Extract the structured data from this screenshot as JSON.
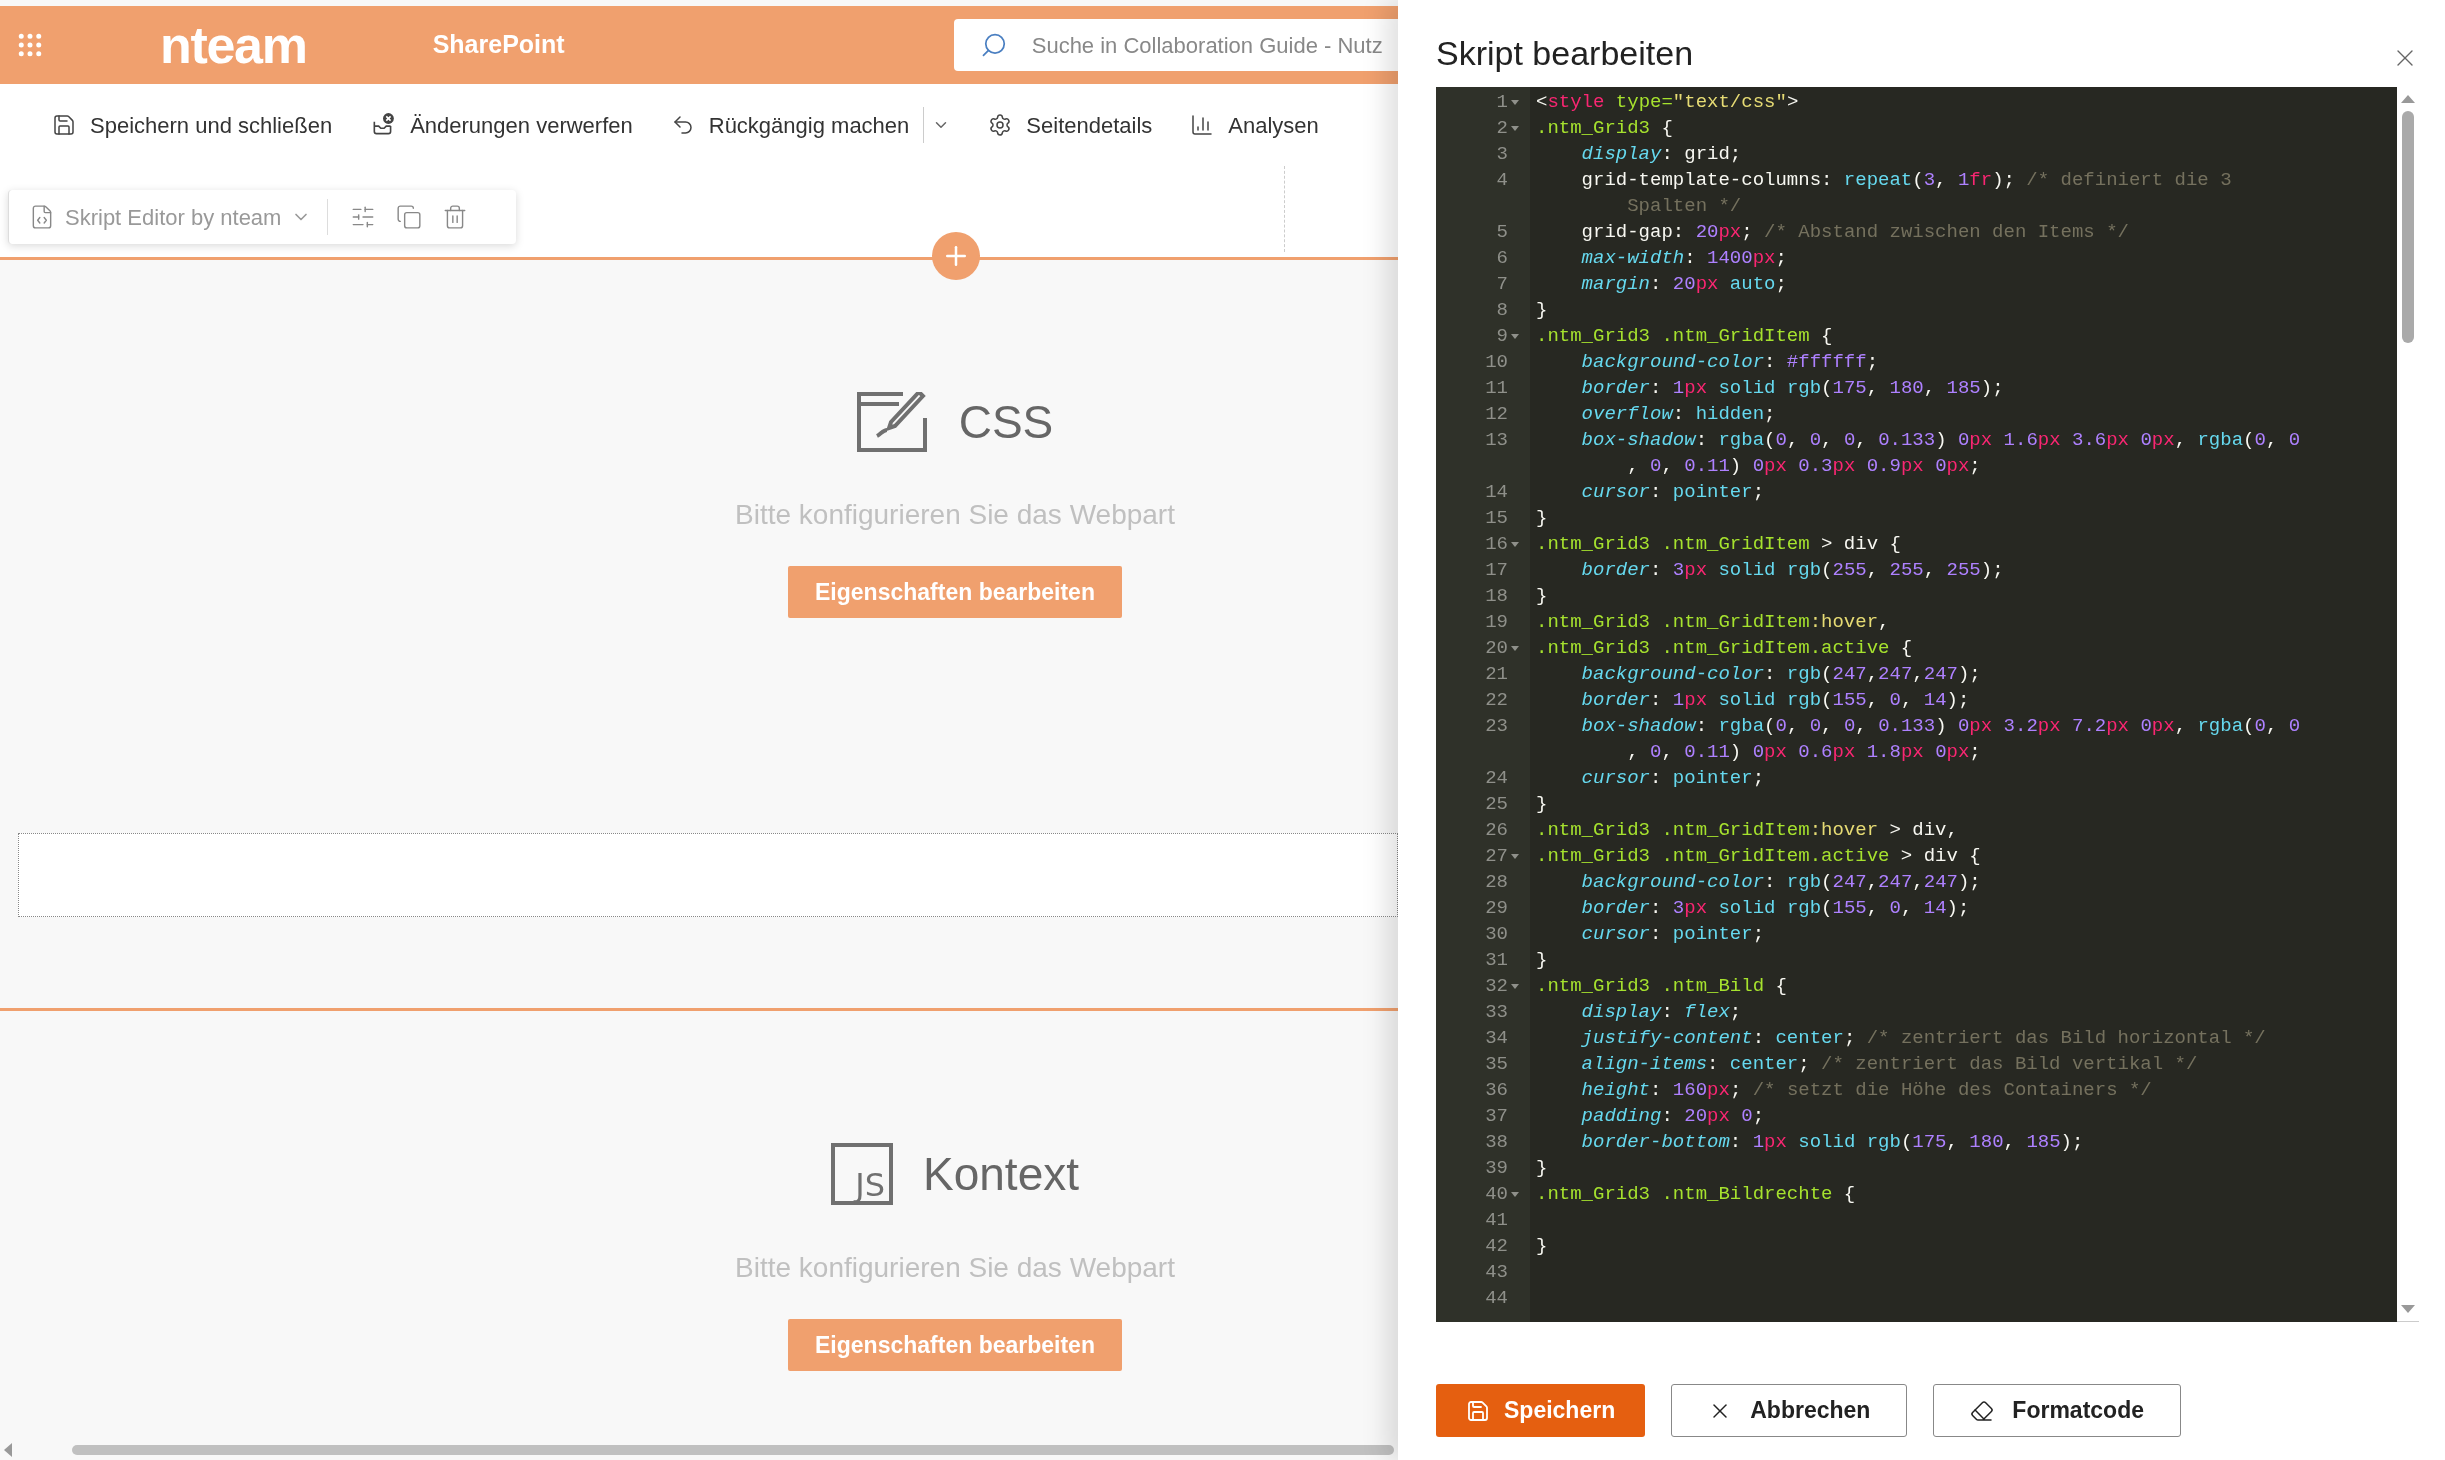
{
  "top_bar": {
    "logo": "nteam",
    "site_name": "SharePoint",
    "search": {
      "placeholder": "Suche in Collaboration Guide - Nutz"
    }
  },
  "command_bar": [
    {
      "label": "Speichern und schließen",
      "dropdown": false
    },
    {
      "label": "Änderungen verwerfen",
      "dropdown": false
    },
    {
      "label": "Rückgängig machen",
      "dropdown": true
    },
    {
      "label": "Seitendetails",
      "dropdown": false
    },
    {
      "label": "Analysen",
      "dropdown": false
    }
  ],
  "webpart_toolbar": {
    "title": "Skript Editor by nteam"
  },
  "sections": [
    {
      "kind": "css",
      "title": "CSS",
      "message": "Bitte konfigurieren Sie das Webpart",
      "button": "Eigenschaften bearbeiten"
    },
    {
      "kind": "js",
      "icon_text": "JS",
      "title": "Kontext",
      "message": "Bitte konfigurieren Sie das Webpart",
      "button": "Eigenschaften bearbeiten"
    }
  ],
  "panel": {
    "title": "Skript bearbeiten",
    "editor": [
      {
        "number": "1",
        "foldable": true,
        "code": [
          {
            "kind": "plain",
            "text": "<"
          },
          {
            "kind": "tag",
            "text": "style"
          },
          {
            "kind": "attr",
            "text": " type="
          },
          {
            "kind": "str",
            "text": "\"text/css\""
          },
          {
            "kind": "plain",
            "text": ">"
          }
        ]
      },
      {
        "number": "2",
        "foldable": true,
        "code": [
          {
            "kind": "sel",
            "text": ".ntm_Grid3"
          },
          {
            "kind": "plain",
            "text": " {"
          }
        ]
      },
      {
        "number": "3",
        "foldable": false,
        "code": [
          {
            "kind": "prop",
            "text": "    display"
          },
          {
            "kind": "plain",
            "text": ": grid;"
          }
        ]
      },
      {
        "number": "4",
        "foldable": false,
        "code": [
          {
            "kind": "plain",
            "text": "    grid-template-columns: "
          },
          {
            "kind": "kw",
            "text": "repeat"
          },
          {
            "kind": "plain",
            "text": "("
          },
          {
            "kind": "num",
            "text": "3"
          },
          {
            "kind": "plain",
            "text": ", "
          },
          {
            "kind": "num",
            "text": "1"
          },
          {
            "kind": "unit",
            "text": "fr"
          },
          {
            "kind": "plain",
            "text": "); "
          },
          {
            "kind": "com",
            "text": "/* definiert die 3"
          }
        ],
        "continuation": [
          {
            "kind": "com",
            "text": "        Spalten */"
          }
        ]
      },
      {
        "number": "5",
        "foldable": false,
        "code": [
          {
            "kind": "plain",
            "text": "    grid-gap: "
          },
          {
            "kind": "num",
            "text": "20"
          },
          {
            "kind": "unit",
            "text": "px"
          },
          {
            "kind": "plain",
            "text": "; "
          },
          {
            "kind": "com",
            "text": "/* Abstand zwischen den Items */"
          }
        ]
      },
      {
        "number": "6",
        "foldable": false,
        "code": [
          {
            "kind": "prop",
            "text": "    max-width"
          },
          {
            "kind": "plain",
            "text": ": "
          },
          {
            "kind": "num",
            "text": "1400"
          },
          {
            "kind": "unit",
            "text": "px"
          },
          {
            "kind": "plain",
            "text": ";"
          }
        ]
      },
      {
        "number": "7",
        "foldable": false,
        "code": [
          {
            "kind": "prop",
            "text": "    margin"
          },
          {
            "kind": "plain",
            "text": ": "
          },
          {
            "kind": "num",
            "text": "20"
          },
          {
            "kind": "unit",
            "text": "px"
          },
          {
            "kind": "kw",
            "text": " auto"
          },
          {
            "kind": "plain",
            "text": ";"
          }
        ]
      },
      {
        "number": "8",
        "foldable": false,
        "code": [
          {
            "kind": "plain",
            "text": "}"
          }
        ]
      },
      {
        "number": "9",
        "foldable": true,
        "code": [
          {
            "kind": "sel",
            "text": ".ntm_Grid3 .ntm_GridItem"
          },
          {
            "kind": "plain",
            "text": " {"
          }
        ]
      },
      {
        "number": "10",
        "foldable": false,
        "code": [
          {
            "kind": "prop",
            "text": "    background-color"
          },
          {
            "kind": "plain",
            "text": ": "
          },
          {
            "kind": "num",
            "text": "#ffffff"
          },
          {
            "kind": "plain",
            "text": ";"
          }
        ]
      },
      {
        "number": "11",
        "foldable": false,
        "code": [
          {
            "kind": "prop",
            "text": "    border"
          },
          {
            "kind": "plain",
            "text": ": "
          },
          {
            "kind": "num",
            "text": "1"
          },
          {
            "kind": "unit",
            "text": "px"
          },
          {
            "kind": "kw",
            "text": " solid"
          },
          {
            "kind": "kw",
            "text": " rgb"
          },
          {
            "kind": "plain",
            "text": "("
          },
          {
            "kind": "num",
            "text": "175"
          },
          {
            "kind": "plain",
            "text": ", "
          },
          {
            "kind": "num",
            "text": "180"
          },
          {
            "kind": "plain",
            "text": ", "
          },
          {
            "kind": "num",
            "text": "185"
          },
          {
            "kind": "plain",
            "text": ");"
          }
        ]
      },
      {
        "number": "12",
        "foldable": false,
        "code": [
          {
            "kind": "prop",
            "text": "    overflow"
          },
          {
            "kind": "plain",
            "text": ": "
          },
          {
            "kind": "kw",
            "text": "hidden"
          },
          {
            "kind": "plain",
            "text": ";"
          }
        ]
      },
      {
        "number": "13",
        "foldable": false,
        "code": [
          {
            "kind": "prop",
            "text": "    box-shadow"
          },
          {
            "kind": "plain",
            "text": ": "
          },
          {
            "kind": "kw",
            "text": "rgba"
          },
          {
            "kind": "plain",
            "text": "("
          },
          {
            "kind": "num",
            "text": "0"
          },
          {
            "kind": "plain",
            "text": ", "
          },
          {
            "kind": "num",
            "text": "0"
          },
          {
            "kind": "plain",
            "text": ", "
          },
          {
            "kind": "num",
            "text": "0"
          },
          {
            "kind": "plain",
            "text": ", "
          },
          {
            "kind": "num",
            "text": "0.133"
          },
          {
            "kind": "plain",
            "text": ") "
          },
          {
            "kind": "num",
            "text": "0"
          },
          {
            "kind": "unit",
            "text": "px"
          },
          {
            "kind": "num",
            "text": " 1.6"
          },
          {
            "kind": "unit",
            "text": "px"
          },
          {
            "kind": "num",
            "text": " 3.6"
          },
          {
            "kind": "unit",
            "text": "px"
          },
          {
            "kind": "num",
            "text": " 0"
          },
          {
            "kind": "unit",
            "text": "px"
          },
          {
            "kind": "plain",
            "text": ", "
          },
          {
            "kind": "kw",
            "text": "rgba"
          },
          {
            "kind": "plain",
            "text": "("
          },
          {
            "kind": "num",
            "text": "0"
          },
          {
            "kind": "plain",
            "text": ", "
          },
          {
            "kind": "num",
            "text": "0"
          }
        ],
        "continuation": [
          {
            "kind": "plain",
            "text": "        , "
          },
          {
            "kind": "num",
            "text": "0"
          },
          {
            "kind": "plain",
            "text": ", "
          },
          {
            "kind": "num",
            "text": "0.11"
          },
          {
            "kind": "plain",
            "text": ") "
          },
          {
            "kind": "num",
            "text": "0"
          },
          {
            "kind": "unit",
            "text": "px"
          },
          {
            "kind": "num",
            "text": " 0.3"
          },
          {
            "kind": "unit",
            "text": "px"
          },
          {
            "kind": "num",
            "text": " 0.9"
          },
          {
            "kind": "unit",
            "text": "px"
          },
          {
            "kind": "num",
            "text": " 0"
          },
          {
            "kind": "unit",
            "text": "px"
          },
          {
            "kind": "plain",
            "text": ";"
          }
        ]
      },
      {
        "number": "14",
        "foldable": false,
        "code": [
          {
            "kind": "prop",
            "text": "    cursor"
          },
          {
            "kind": "plain",
            "text": ": "
          },
          {
            "kind": "kw",
            "text": "pointer"
          },
          {
            "kind": "plain",
            "text": ";"
          }
        ]
      },
      {
        "number": "15",
        "foldable": false,
        "code": [
          {
            "kind": "plain",
            "text": "}"
          }
        ]
      },
      {
        "number": "16",
        "foldable": true,
        "code": [
          {
            "kind": "sel",
            "text": ".ntm_Grid3 .ntm_GridItem"
          },
          {
            "kind": "plain",
            "text": " > div {"
          }
        ]
      },
      {
        "number": "17",
        "foldable": false,
        "code": [
          {
            "kind": "prop",
            "text": "    border"
          },
          {
            "kind": "plain",
            "text": ": "
          },
          {
            "kind": "num",
            "text": "3"
          },
          {
            "kind": "unit",
            "text": "px"
          },
          {
            "kind": "kw",
            "text": " solid"
          },
          {
            "kind": "kw",
            "text": " rgb"
          },
          {
            "kind": "plain",
            "text": "("
          },
          {
            "kind": "num",
            "text": "255"
          },
          {
            "kind": "plain",
            "text": ", "
          },
          {
            "kind": "num",
            "text": "255"
          },
          {
            "kind": "plain",
            "text": ", "
          },
          {
            "kind": "num",
            "text": "255"
          },
          {
            "kind": "plain",
            "text": ");"
          }
        ]
      },
      {
        "number": "18",
        "foldable": false,
        "code": [
          {
            "kind": "plain",
            "text": "}"
          }
        ]
      },
      {
        "number": "19",
        "foldable": false,
        "code": [
          {
            "kind": "sel",
            "text": ".ntm_Grid3 .ntm_GridItem"
          },
          {
            "kind": "pseudo",
            "text": ":hover"
          },
          {
            "kind": "plain",
            "text": ","
          }
        ]
      },
      {
        "number": "20",
        "foldable": true,
        "code": [
          {
            "kind": "sel",
            "text": ".ntm_Grid3 .ntm_GridItem.active"
          },
          {
            "kind": "plain",
            "text": " {"
          }
        ]
      },
      {
        "number": "21",
        "foldable": false,
        "code": [
          {
            "kind": "prop",
            "text": "    background-color"
          },
          {
            "kind": "plain",
            "text": ": "
          },
          {
            "kind": "kw",
            "text": "rgb"
          },
          {
            "kind": "plain",
            "text": "("
          },
          {
            "kind": "num",
            "text": "247"
          },
          {
            "kind": "plain",
            "text": ","
          },
          {
            "kind": "num",
            "text": "247"
          },
          {
            "kind": "plain",
            "text": ","
          },
          {
            "kind": "num",
            "text": "247"
          },
          {
            "kind": "plain",
            "text": ");"
          }
        ]
      },
      {
        "number": "22",
        "foldable": false,
        "code": [
          {
            "kind": "prop",
            "text": "    border"
          },
          {
            "kind": "plain",
            "text": ": "
          },
          {
            "kind": "num",
            "text": "1"
          },
          {
            "kind": "unit",
            "text": "px"
          },
          {
            "kind": "kw",
            "text": " solid"
          },
          {
            "kind": "kw",
            "text": " rgb"
          },
          {
            "kind": "plain",
            "text": "("
          },
          {
            "kind": "num",
            "text": "155"
          },
          {
            "kind": "plain",
            "text": ", "
          },
          {
            "kind": "num",
            "text": "0"
          },
          {
            "kind": "plain",
            "text": ", "
          },
          {
            "kind": "num",
            "text": "14"
          },
          {
            "kind": "plain",
            "text": ");"
          }
        ]
      },
      {
        "number": "23",
        "foldable": false,
        "code": [
          {
            "kind": "prop",
            "text": "    box-shadow"
          },
          {
            "kind": "plain",
            "text": ": "
          },
          {
            "kind": "kw",
            "text": "rgba"
          },
          {
            "kind": "plain",
            "text": "("
          },
          {
            "kind": "num",
            "text": "0"
          },
          {
            "kind": "plain",
            "text": ", "
          },
          {
            "kind": "num",
            "text": "0"
          },
          {
            "kind": "plain",
            "text": ", "
          },
          {
            "kind": "num",
            "text": "0"
          },
          {
            "kind": "plain",
            "text": ", "
          },
          {
            "kind": "num",
            "text": "0.133"
          },
          {
            "kind": "plain",
            "text": ") "
          },
          {
            "kind": "num",
            "text": "0"
          },
          {
            "kind": "unit",
            "text": "px"
          },
          {
            "kind": "num",
            "text": " 3.2"
          },
          {
            "kind": "unit",
            "text": "px"
          },
          {
            "kind": "num",
            "text": " 7.2"
          },
          {
            "kind": "unit",
            "text": "px"
          },
          {
            "kind": "num",
            "text": " 0"
          },
          {
            "kind": "unit",
            "text": "px"
          },
          {
            "kind": "plain",
            "text": ", "
          },
          {
            "kind": "kw",
            "text": "rgba"
          },
          {
            "kind": "plain",
            "text": "("
          },
          {
            "kind": "num",
            "text": "0"
          },
          {
            "kind": "plain",
            "text": ", "
          },
          {
            "kind": "num",
            "text": "0"
          }
        ],
        "continuation": [
          {
            "kind": "plain",
            "text": "        , "
          },
          {
            "kind": "num",
            "text": "0"
          },
          {
            "kind": "plain",
            "text": ", "
          },
          {
            "kind": "num",
            "text": "0.11"
          },
          {
            "kind": "plain",
            "text": ") "
          },
          {
            "kind": "num",
            "text": "0"
          },
          {
            "kind": "unit",
            "text": "px"
          },
          {
            "kind": "num",
            "text": " 0.6"
          },
          {
            "kind": "unit",
            "text": "px"
          },
          {
            "kind": "num",
            "text": " 1.8"
          },
          {
            "kind": "unit",
            "text": "px"
          },
          {
            "kind": "num",
            "text": " 0"
          },
          {
            "kind": "unit",
            "text": "px"
          },
          {
            "kind": "plain",
            "text": ";"
          }
        ]
      },
      {
        "number": "24",
        "foldable": false,
        "code": [
          {
            "kind": "prop",
            "text": "    cursor"
          },
          {
            "kind": "plain",
            "text": ": "
          },
          {
            "kind": "kw",
            "text": "pointer"
          },
          {
            "kind": "plain",
            "text": ";"
          }
        ]
      },
      {
        "number": "25",
        "foldable": false,
        "code": [
          {
            "kind": "plain",
            "text": "}"
          }
        ]
      },
      {
        "number": "26",
        "foldable": false,
        "code": [
          {
            "kind": "sel",
            "text": ".ntm_Grid3 .ntm_GridItem"
          },
          {
            "kind": "pseudo",
            "text": ":hover"
          },
          {
            "kind": "plain",
            "text": " > div,"
          }
        ]
      },
      {
        "number": "27",
        "foldable": true,
        "code": [
          {
            "kind": "sel",
            "text": ".ntm_Grid3 .ntm_GridItem.active"
          },
          {
            "kind": "plain",
            "text": " > div {"
          }
        ]
      },
      {
        "number": "28",
        "foldable": false,
        "code": [
          {
            "kind": "prop",
            "text": "    background-color"
          },
          {
            "kind": "plain",
            "text": ": "
          },
          {
            "kind": "kw",
            "text": "rgb"
          },
          {
            "kind": "plain",
            "text": "("
          },
          {
            "kind": "num",
            "text": "247"
          },
          {
            "kind": "plain",
            "text": ","
          },
          {
            "kind": "num",
            "text": "247"
          },
          {
            "kind": "plain",
            "text": ","
          },
          {
            "kind": "num",
            "text": "247"
          },
          {
            "kind": "plain",
            "text": ");"
          }
        ]
      },
      {
        "number": "29",
        "foldable": false,
        "code": [
          {
            "kind": "prop",
            "text": "    border"
          },
          {
            "kind": "plain",
            "text": ": "
          },
          {
            "kind": "num",
            "text": "3"
          },
          {
            "kind": "unit",
            "text": "px"
          },
          {
            "kind": "kw",
            "text": " solid"
          },
          {
            "kind": "kw",
            "text": " rgb"
          },
          {
            "kind": "plain",
            "text": "("
          },
          {
            "kind": "num",
            "text": "155"
          },
          {
            "kind": "plain",
            "text": ", "
          },
          {
            "kind": "num",
            "text": "0"
          },
          {
            "kind": "plain",
            "text": ", "
          },
          {
            "kind": "num",
            "text": "14"
          },
          {
            "kind": "plain",
            "text": ");"
          }
        ]
      },
      {
        "number": "30",
        "foldable": false,
        "code": [
          {
            "kind": "prop",
            "text": "    cursor"
          },
          {
            "kind": "plain",
            "text": ": "
          },
          {
            "kind": "kw",
            "text": "pointer"
          },
          {
            "kind": "plain",
            "text": ";"
          }
        ]
      },
      {
        "number": "31",
        "foldable": false,
        "code": [
          {
            "kind": "plain",
            "text": "}"
          }
        ]
      },
      {
        "number": "32",
        "foldable": true,
        "code": [
          {
            "kind": "sel",
            "text": ".ntm_Grid3 .ntm_Bild"
          },
          {
            "kind": "plain",
            "text": " {"
          }
        ]
      },
      {
        "number": "33",
        "foldable": false,
        "code": [
          {
            "kind": "prop",
            "text": "    display"
          },
          {
            "kind": "plain",
            "text": ": "
          },
          {
            "kind": "kwi",
            "text": "flex"
          },
          {
            "kind": "plain",
            "text": ";"
          }
        ]
      },
      {
        "number": "34",
        "foldable": false,
        "code": [
          {
            "kind": "prop",
            "text": "    justify-content"
          },
          {
            "kind": "plain",
            "text": ": "
          },
          {
            "kind": "kw",
            "text": "center"
          },
          {
            "kind": "plain",
            "text": "; "
          },
          {
            "kind": "com",
            "text": "/* zentriert das Bild horizontal */"
          }
        ]
      },
      {
        "number": "35",
        "foldable": false,
        "code": [
          {
            "kind": "prop",
            "text": "    align-items"
          },
          {
            "kind": "plain",
            "text": ": "
          },
          {
            "kind": "kw",
            "text": "center"
          },
          {
            "kind": "plain",
            "text": "; "
          },
          {
            "kind": "com",
            "text": "/* zentriert das Bild vertikal */"
          }
        ]
      },
      {
        "number": "36",
        "foldable": false,
        "code": [
          {
            "kind": "prop",
            "text": "    height"
          },
          {
            "kind": "plain",
            "text": ": "
          },
          {
            "kind": "num",
            "text": "160"
          },
          {
            "kind": "unit",
            "text": "px"
          },
          {
            "kind": "plain",
            "text": "; "
          },
          {
            "kind": "com",
            "text": "/* setzt die Höhe des Containers */"
          }
        ]
      },
      {
        "number": "37",
        "foldable": false,
        "code": [
          {
            "kind": "prop",
            "text": "    padding"
          },
          {
            "kind": "plain",
            "text": ": "
          },
          {
            "kind": "num",
            "text": "20"
          },
          {
            "kind": "unit",
            "text": "px"
          },
          {
            "kind": "num",
            "text": " 0"
          },
          {
            "kind": "plain",
            "text": ";"
          }
        ]
      },
      {
        "number": "38",
        "foldable": false,
        "code": [
          {
            "kind": "prop",
            "text": "    border-bottom"
          },
          {
            "kind": "plain",
            "text": ": "
          },
          {
            "kind": "num",
            "text": "1"
          },
          {
            "kind": "unit",
            "text": "px"
          },
          {
            "kind": "kw",
            "text": " solid"
          },
          {
            "kind": "kw",
            "text": " rgb"
          },
          {
            "kind": "plain",
            "text": "("
          },
          {
            "kind": "num",
            "text": "175"
          },
          {
            "kind": "plain",
            "text": ", "
          },
          {
            "kind": "num",
            "text": "180"
          },
          {
            "kind": "plain",
            "text": ", "
          },
          {
            "kind": "num",
            "text": "185"
          },
          {
            "kind": "plain",
            "text": ");"
          }
        ]
      },
      {
        "number": "39",
        "foldable": false,
        "code": [
          {
            "kind": "plain",
            "text": "}"
          }
        ]
      },
      {
        "number": "40",
        "foldable": true,
        "code": [
          {
            "kind": "sel",
            "text": ".ntm_Grid3 .ntm_Bildrechte"
          },
          {
            "kind": "plain",
            "text": " {"
          }
        ]
      },
      {
        "number": "41",
        "foldable": false
      },
      {
        "number": "42",
        "foldable": false,
        "code": [
          {
            "kind": "plain",
            "text": "}"
          }
        ]
      },
      {
        "number": "43",
        "foldable": false
      },
      {
        "number": "44",
        "foldable": false
      }
    ],
    "buttons": [
      {
        "label": "Speichern",
        "kind": "primary"
      },
      {
        "label": "Abbrechen",
        "kind": "default"
      },
      {
        "label": "Formatcode",
        "kind": "default"
      }
    ]
  }
}
